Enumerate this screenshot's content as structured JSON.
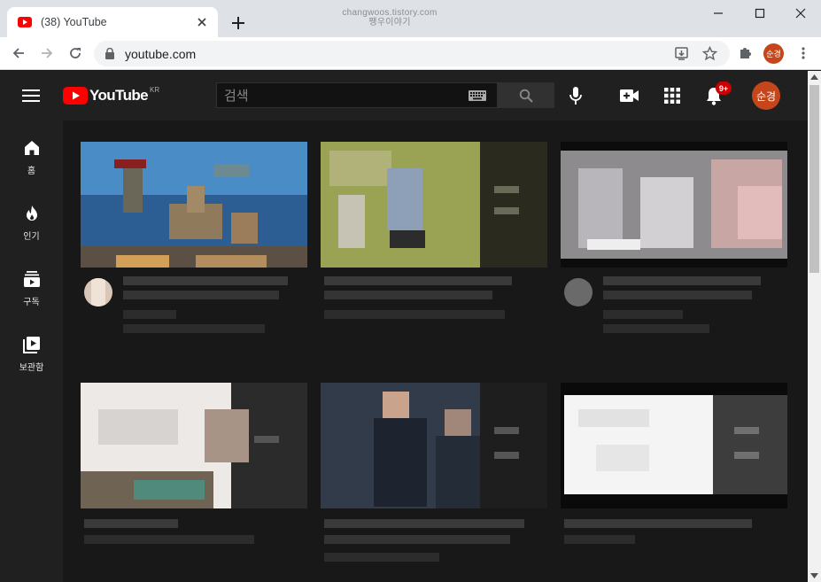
{
  "browser": {
    "tab_title": "(38) YouTube",
    "watermark_line1": "changwoos.tistory.com",
    "watermark_line2": "쨍우이야기",
    "url": "youtube.com",
    "profile_initials": "순경"
  },
  "youtube": {
    "logo_text": "YouTube",
    "region": "KR",
    "search_placeholder": "검색",
    "notification_count": "9+",
    "avatar_text": "순경",
    "guide": [
      {
        "label": "홈",
        "icon": "home-icon"
      },
      {
        "label": "인기",
        "icon": "trending-icon"
      },
      {
        "label": "구독",
        "icon": "subscriptions-icon"
      },
      {
        "label": "보관함",
        "icon": "library-icon"
      }
    ]
  },
  "colors": {
    "brand_red": "#ff0000",
    "header_bg": "#202020",
    "page_bg": "#181818",
    "avatar_bg": "#c6461c",
    "badge_red": "#cc0000"
  }
}
